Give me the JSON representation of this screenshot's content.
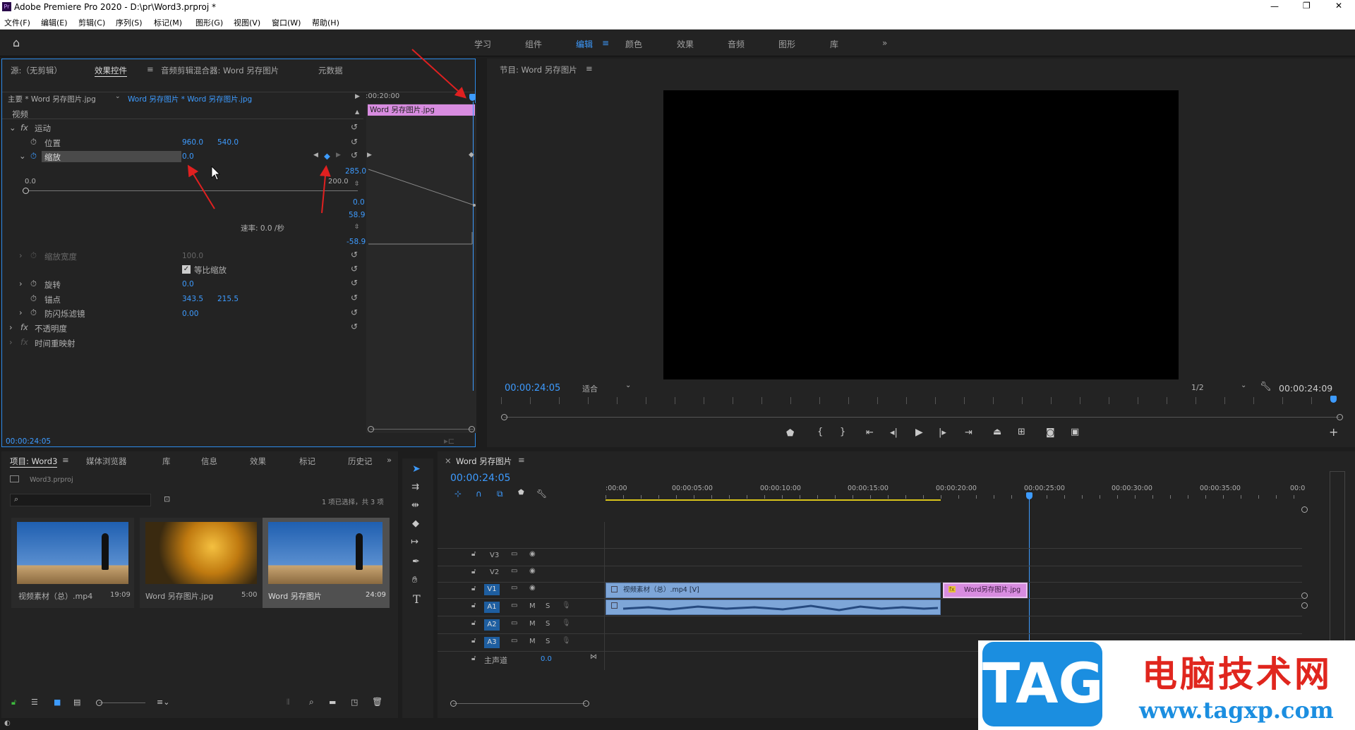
{
  "window": {
    "title": "Adobe Premiere Pro 2020 - D:\\pr\\Word3.prproj *"
  },
  "menu": [
    "文件(F)",
    "编辑(E)",
    "剪辑(C)",
    "序列(S)",
    "标记(M)",
    "图形(G)",
    "视图(V)",
    "窗口(W)",
    "帮助(H)"
  ],
  "workspaces": [
    "学习",
    "组件",
    "编辑",
    "颜色",
    "效果",
    "音频",
    "图形",
    "库"
  ],
  "active_workspace": "编辑",
  "effect_panel": {
    "tabs": [
      "源:（无剪辑）",
      "效果控件",
      "音频剪辑混合器: Word 另存图片",
      "元数据"
    ],
    "source_master": "主要 * Word 另存图片.jpg",
    "source_clip": "Word 另存图片 * Word 另存图片.jpg",
    "ruler_time": ":00:20:00",
    "clip_block": "Word 另存图片.jpg",
    "video_header": "视频",
    "motion": "运动",
    "position_label": "位置",
    "position_x": "960.0",
    "position_y": "540.0",
    "scale_label": "缩放",
    "scale_value": "0.0",
    "slider_min": "0.0",
    "slider_max": "200.0",
    "graph_top": "285.0",
    "graph_mid": "0.0",
    "graph_vel_top": "58.9",
    "graph_vel_bot": "-58.9",
    "rate": "速率: 0.0 /秒",
    "scale_width_label": "缩放宽度",
    "scale_width_value": "100.0",
    "uniform_scale": "等比缩放",
    "rotation_label": "旋转",
    "rotation_value": "0.0",
    "anchor_label": "锚点",
    "anchor_x": "343.5",
    "anchor_y": "215.5",
    "flicker_label": "防闪烁滤镜",
    "flicker_value": "0.00",
    "opacity": "不透明度",
    "time_remap": "时间重映射",
    "timecode": "00:00:24:05"
  },
  "program": {
    "title": "节目: Word 另存图片",
    "timecode_left": "00:00:24:05",
    "fit": "适合",
    "resolution": "1/2",
    "timecode_right": "00:00:24:09"
  },
  "project": {
    "tabs": [
      "项目: Word3",
      "媒体浏览器",
      "库",
      "信息",
      "效果",
      "标记",
      "历史记"
    ],
    "file": "Word3.prproj",
    "count": "1 项已选择，共 3 项",
    "items": [
      {
        "name": "视频素材（总）.mp4",
        "duration": "19:09"
      },
      {
        "name": "Word 另存图片.jpg",
        "duration": "5:00"
      },
      {
        "name": "Word 另存图片",
        "duration": "24:09"
      }
    ]
  },
  "timeline": {
    "title": "Word 另存图片",
    "timecode": "00:00:24:05",
    "ruler": ":00:00",
    "ruler_ticks": [
      "00:00:05:00",
      "00:00:10:00",
      "00:00:15:00",
      "00:00:20:00",
      "00:00:25:00",
      "00:00:30:00",
      "00:00:35:00",
      "00:0"
    ],
    "tracks": [
      "V3",
      "V2",
      "V1",
      "A1",
      "A2",
      "A3"
    ],
    "master": "主声道",
    "master_value": "0.0",
    "clip_video": "视频素材（总）.mp4 [V]",
    "clip_image": "Word另存图片.jpg",
    "m": "M",
    "s": "S"
  },
  "watermark": {
    "tag": "TAG",
    "site_cn": "电脑技术网",
    "url": "www.tagxp.com"
  },
  "colors": {
    "accent": "#3d9bff",
    "clip_pink": "#d88ce0",
    "clip_blue": "#7ea6d8",
    "arrow": "#e02020"
  }
}
